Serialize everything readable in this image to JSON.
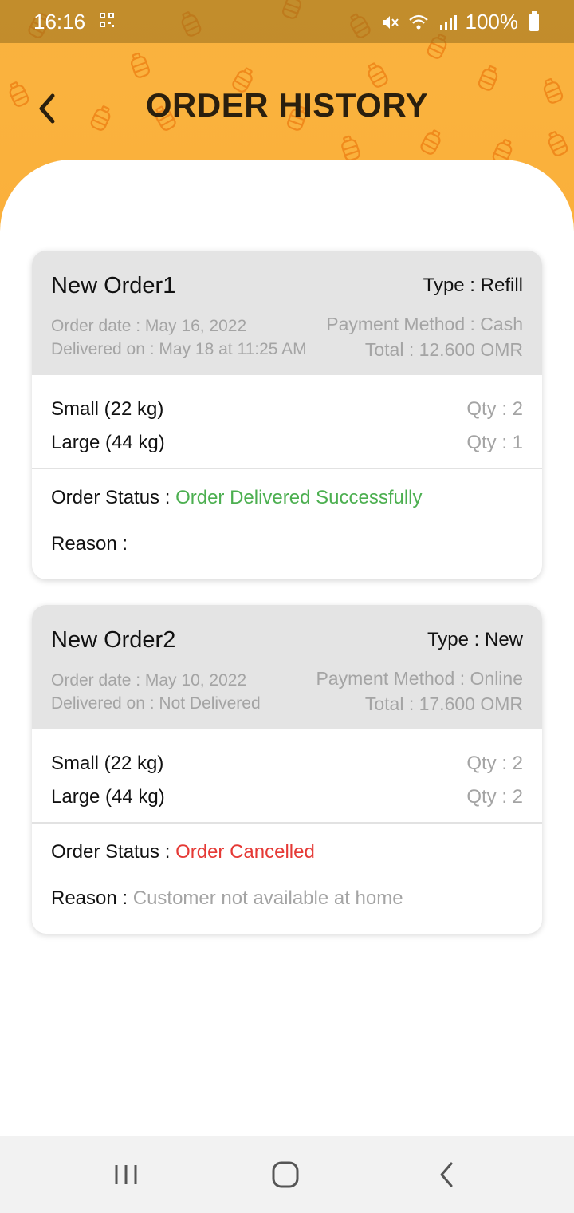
{
  "status_bar": {
    "time": "16:16",
    "battery": "100%",
    "icons": [
      "qr-icon",
      "mute-icon",
      "wifi-icon",
      "signal-icon",
      "battery-icon"
    ]
  },
  "header": {
    "title": "ORDER HISTORY",
    "back_icon": "chevron-left-icon",
    "accent_color": "#fbb03b"
  },
  "orders": [
    {
      "name": "New Order1",
      "type": "Type : Refill",
      "order_date": "Order date : May 16, 2022",
      "delivered_on": "Delivered on : May 18 at 11:25 AM",
      "payment_method": "Payment Method : Cash",
      "total": "Total : 12.600 OMR",
      "items": [
        {
          "name": "Small (22 kg)",
          "qty": "Qty : 2"
        },
        {
          "name": "Large (44 kg)",
          "qty": "Qty : 1"
        }
      ],
      "status_label": "Order Status : ",
      "status_value": "Order Delivered Successfully",
      "status_color": "#4caf50",
      "reason_label": "Reason : ",
      "reason_value": ""
    },
    {
      "name": "New Order2",
      "type": "Type : New",
      "order_date": "Order date : May 10, 2022",
      "delivered_on": "Delivered on : Not Delivered",
      "payment_method": "Payment Method : Online",
      "total": "Total : 17.600 OMR",
      "items": [
        {
          "name": "Small (22 kg)",
          "qty": "Qty : 2"
        },
        {
          "name": "Large (44 kg)",
          "qty": "Qty : 2"
        }
      ],
      "status_label": "Order Status : ",
      "status_value": "Order Cancelled",
      "status_color": "#e53935",
      "reason_label": "Reason : ",
      "reason_value": "Customer not available at home"
    }
  ],
  "nav_bar": {
    "icons": [
      "recent-apps-icon",
      "home-icon",
      "back-icon"
    ]
  }
}
